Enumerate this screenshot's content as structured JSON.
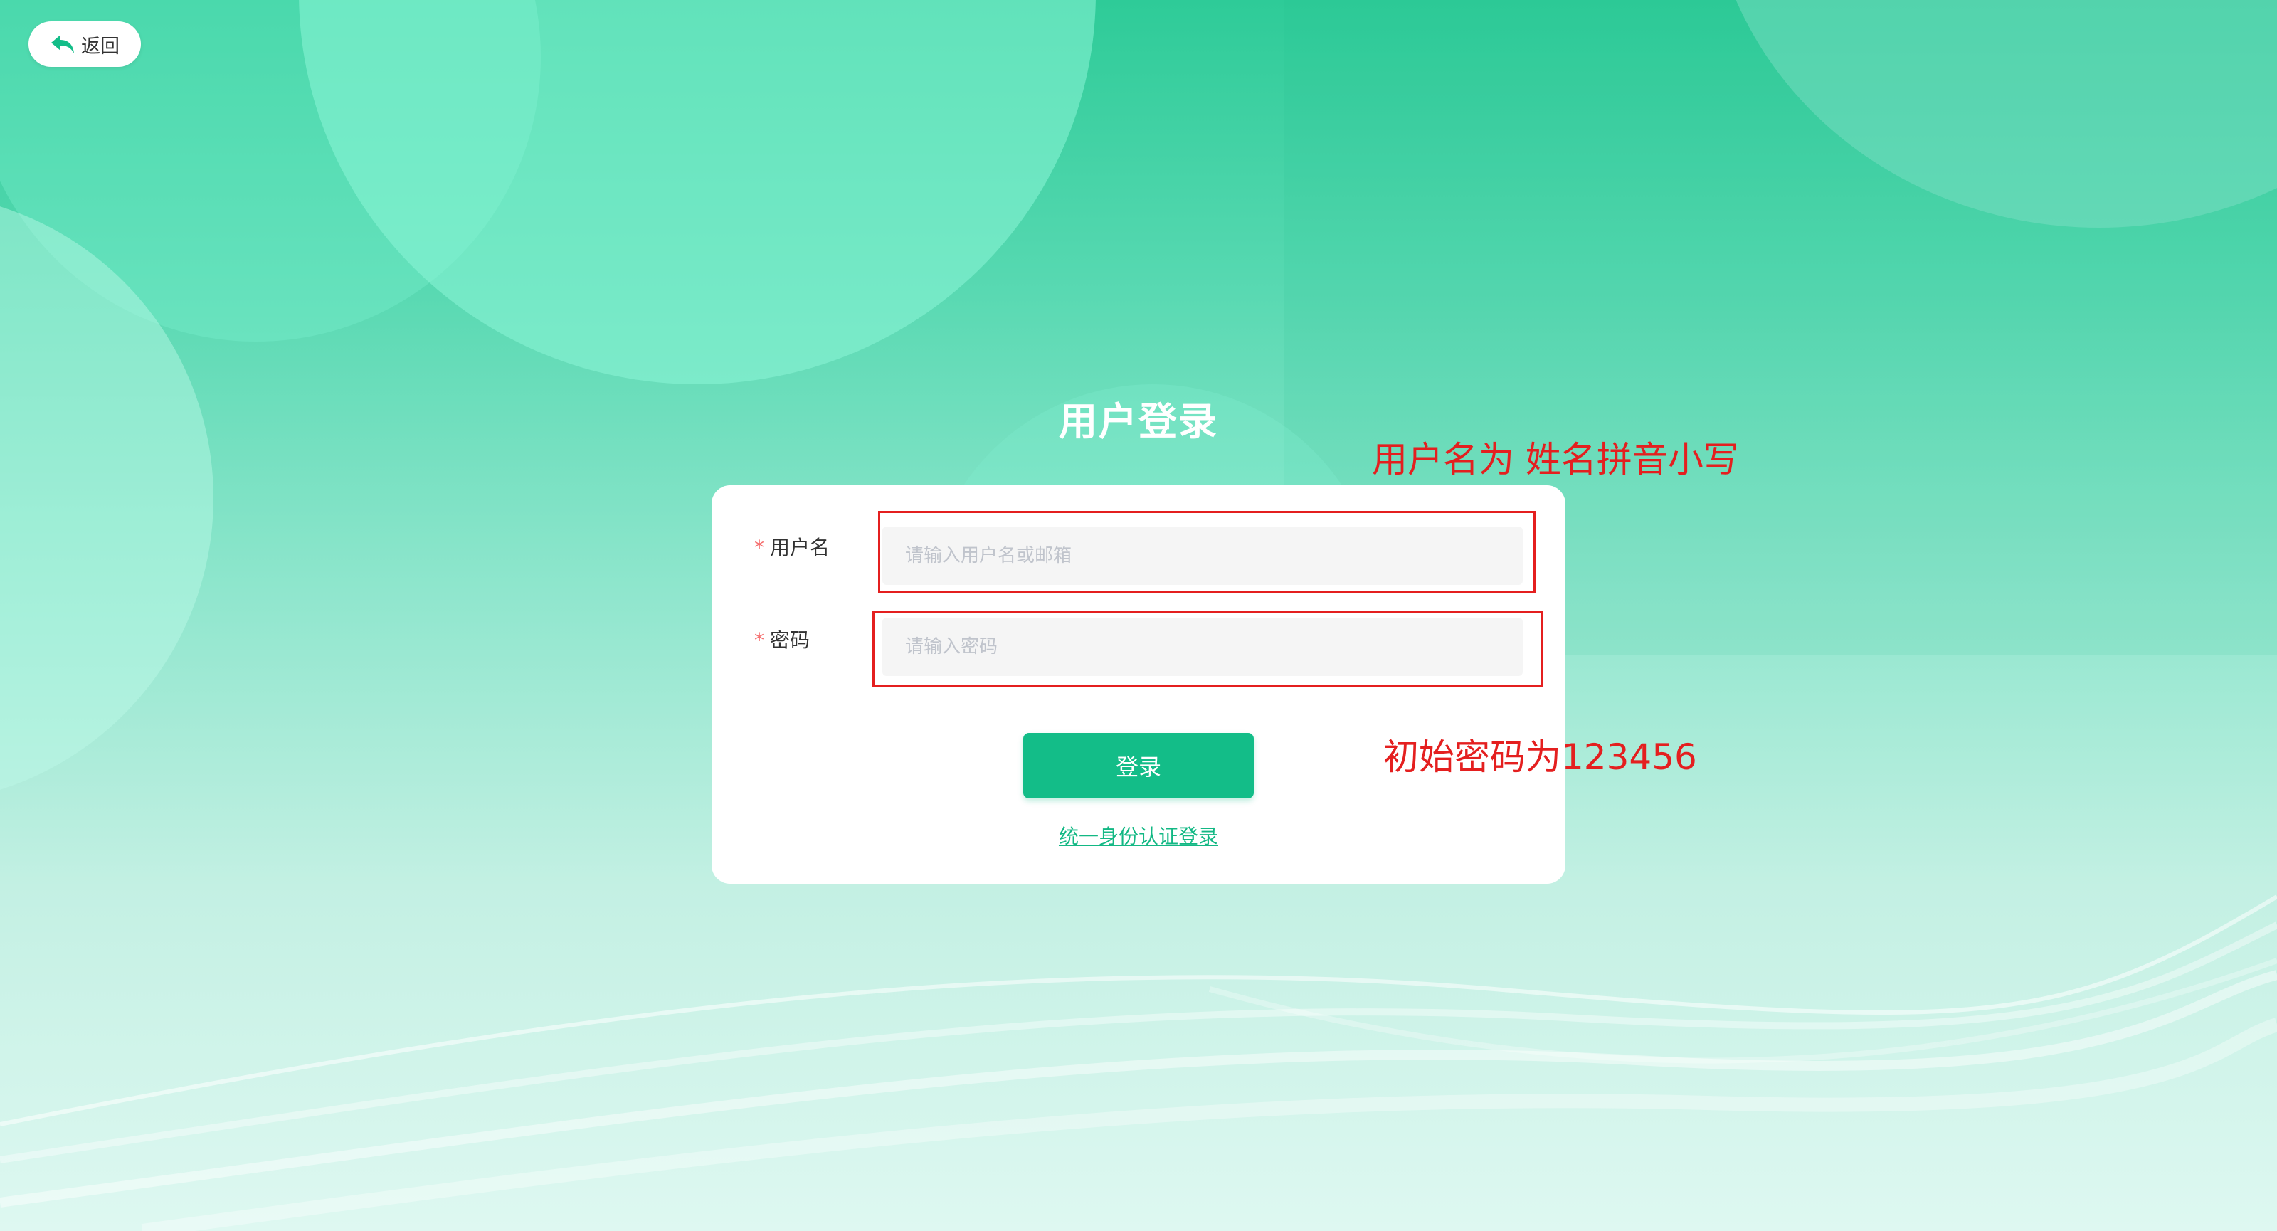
{
  "header": {
    "back_label": "返回"
  },
  "login": {
    "title": "用户登录",
    "username": {
      "label": "用户名",
      "required_mark": "*",
      "placeholder": "请输入用户名或邮箱",
      "value": ""
    },
    "password": {
      "label": "密码",
      "required_mark": "*",
      "placeholder": "请输入密码",
      "value": ""
    },
    "submit_label": "登录",
    "sso_link": "统一身份认证登录"
  },
  "annotations": {
    "username_note": "用户名为 姓名拼音小写",
    "password_note": "初始密码为123456",
    "color": "#e41f1f"
  },
  "theme": {
    "accent": "#13bd88",
    "background": "#2ecb98",
    "required": "#f56c6c"
  },
  "icons": {
    "back": "reply-arrow-icon"
  }
}
